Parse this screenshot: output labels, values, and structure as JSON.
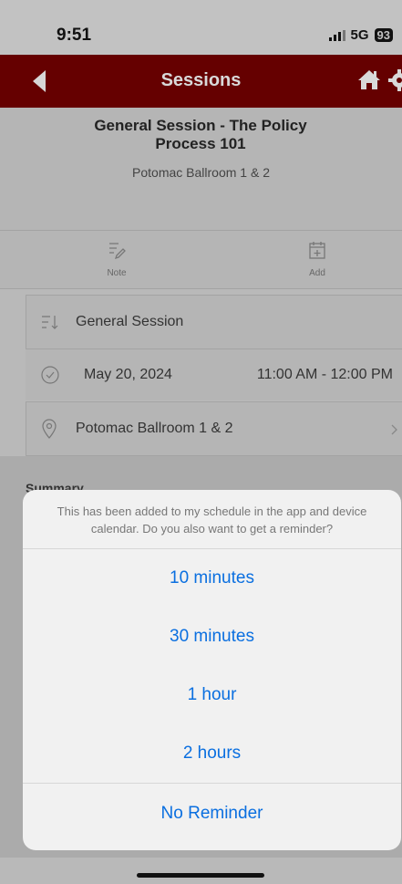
{
  "status_bar": {
    "time": "9:51",
    "network": "5G",
    "battery": "93"
  },
  "header": {
    "title": "Sessions"
  },
  "session": {
    "title": "General Session - The Policy Process 101",
    "room": "Potomac Ballroom 1 & 2"
  },
  "actions": [
    {
      "label": "Note",
      "icon": "note-edit-icon"
    },
    {
      "label": "Add",
      "icon": "calendar-add-icon"
    }
  ],
  "details": {
    "track": "General Session",
    "date": "May 20, 2024",
    "time": "11:00 AM - 12:00 PM",
    "location": "Potomac Ballroom 1 & 2"
  },
  "summary_label": "Summary",
  "reminder_sheet": {
    "message": "This has been added to my schedule in the app and device calendar.  Do you also want to get a reminder?",
    "options": [
      "10 minutes",
      "30 minutes",
      "1 hour",
      "2 hours"
    ],
    "cancel": "No Reminder"
  },
  "colors": {
    "header": "#650000",
    "accent": "#0a6fe0"
  }
}
